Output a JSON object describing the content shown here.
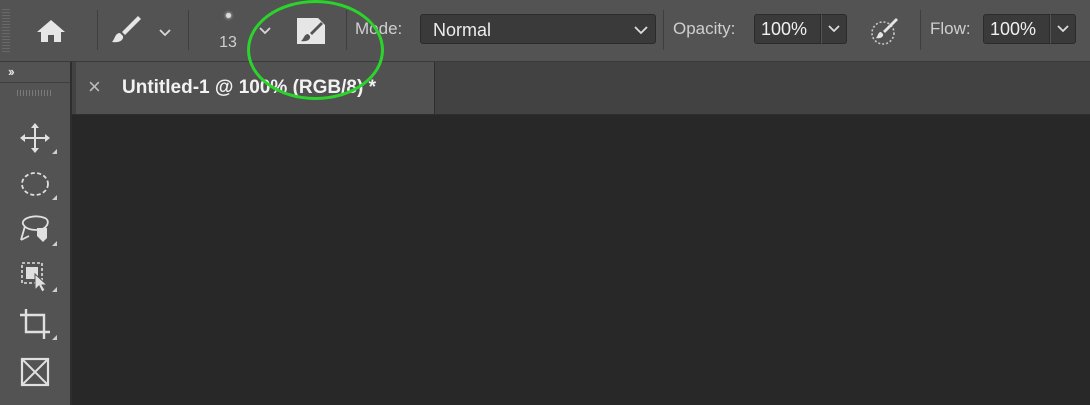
{
  "options_bar": {
    "home_icon": "home-icon",
    "brush_tool_icon": "brush-icon",
    "brush_size": "13",
    "brush_settings_icon": "brush-settings-panel-icon",
    "mode_label": "Mode:",
    "mode_value": "Normal",
    "opacity_label": "Opacity:",
    "opacity_value": "100%",
    "pressure_icon": "pressure-opacity-icon",
    "flow_label": "Flow:",
    "flow_value": "100%"
  },
  "toolbar": {
    "collapse_label": "››",
    "tools": [
      {
        "name": "move-tool",
        "icon": "move-icon"
      },
      {
        "name": "marquee-tool",
        "icon": "elliptical-marquee-icon"
      },
      {
        "name": "lasso-tool",
        "icon": "magnetic-lasso-icon"
      },
      {
        "name": "object-selection-tool",
        "icon": "object-selection-icon"
      },
      {
        "name": "crop-tool",
        "icon": "crop-icon"
      },
      {
        "name": "frame-tool",
        "icon": "frame-icon"
      }
    ]
  },
  "document": {
    "tab_close": "×",
    "tab_title": "Untitled-1 @ 100% (RGB/8) *"
  },
  "colors": {
    "options_bg": "#535353",
    "workspace_bg": "#282828",
    "highlight": "#2bd42b"
  }
}
